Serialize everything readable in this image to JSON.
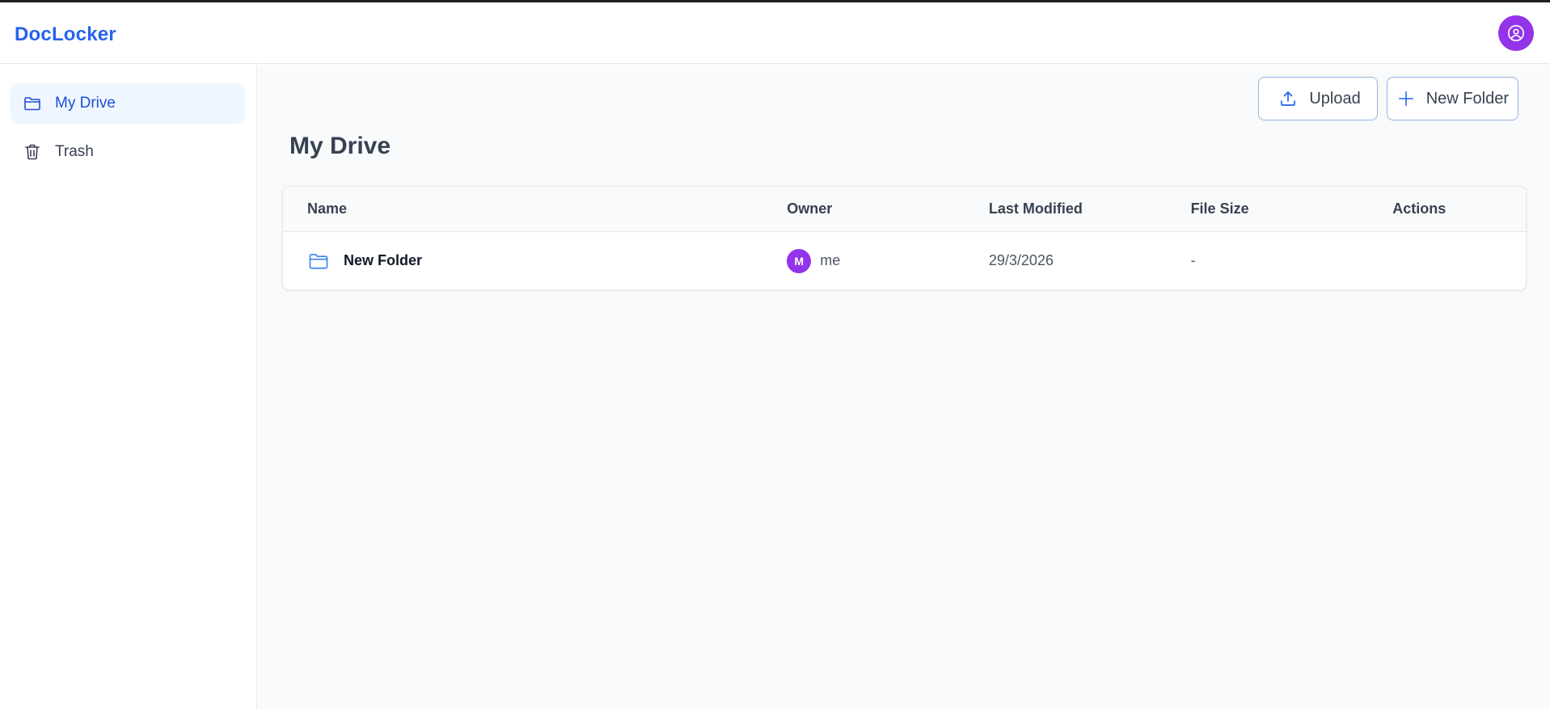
{
  "app": {
    "brand": "DocLocker"
  },
  "sidebar": {
    "items": [
      {
        "label": "My Drive",
        "icon": "folder-open-icon",
        "active": true
      },
      {
        "label": "Trash",
        "icon": "trash-icon",
        "active": false
      }
    ]
  },
  "toolbar": {
    "upload_label": "Upload",
    "new_folder_label": "New Folder"
  },
  "main": {
    "title": "My Drive"
  },
  "table": {
    "columns": [
      "Name",
      "Owner",
      "Last Modified",
      "File Size",
      "Actions"
    ],
    "rows": [
      {
        "name": "New Folder",
        "type": "folder",
        "owner_initial": "M",
        "owner": "me",
        "last_modified": "29/3/2026",
        "file_size": "-"
      }
    ]
  },
  "colors": {
    "brand": "#2563eb",
    "avatar": "#9333ea",
    "active_nav_bg": "#eff6ff",
    "folder_icon": "#3b82f6"
  }
}
